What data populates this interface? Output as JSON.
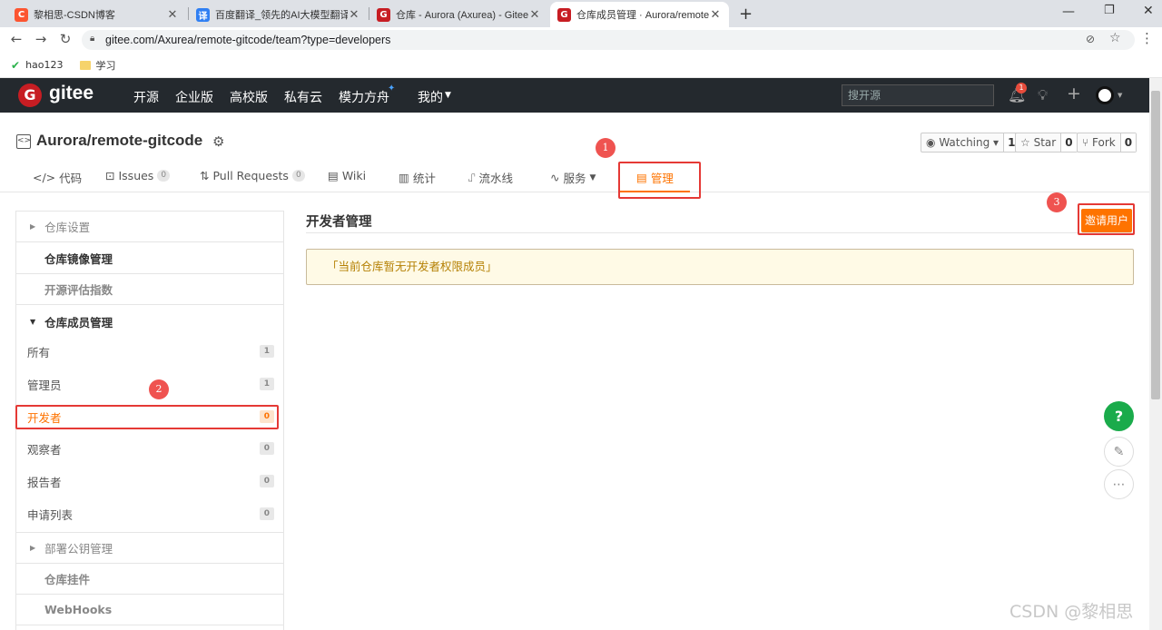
{
  "browser": {
    "tabs": [
      {
        "title": "黎相思-CSDN博客",
        "favicon_text": "C",
        "favicon_color": "#fc5531"
      },
      {
        "title": "百度翻译_领先的AI大模型翻译_支",
        "favicon_text": "译",
        "favicon_color": "#2f7ff3"
      },
      {
        "title": "仓库 - Aurora (Axurea) - Gitee.c",
        "favicon_text": "G",
        "favicon_color": "#c71d23"
      },
      {
        "title": "仓库成员管理 · Aurora/remote-g",
        "favicon_text": "G",
        "favicon_color": "#c71d23"
      }
    ],
    "url": "gitee.com/Axurea/remote-gitcode/team?type=developers",
    "bookmarks": [
      {
        "label": "hao123"
      },
      {
        "label": "学习"
      }
    ]
  },
  "gitee_header": {
    "brand": "gitee",
    "nav": [
      "开源",
      "企业版",
      "高校版",
      "私有云",
      "模力方舟",
      "我的"
    ],
    "search_placeholder": "搜开源",
    "notification_count": "1"
  },
  "repo": {
    "name": "Aurora/remote-gitcode",
    "watch_label": "Watching",
    "watch_count": "1",
    "star_label": "Star",
    "star_count": "0",
    "fork_label": "Fork",
    "fork_count": "0"
  },
  "repo_tabs": {
    "code": "代码",
    "issues": "Issues",
    "issues_count": "0",
    "pulls": "Pull Requests",
    "pulls_count": "0",
    "wiki": "Wiki",
    "stats": "统计",
    "pipeline": "流水线",
    "services": "服务",
    "manage": "管理"
  },
  "sidebar": {
    "repo_settings": "仓库设置",
    "mirror": "仓库镜像管理",
    "open_source_index": "开源评估指数",
    "members": "仓库成员管理",
    "member_items": [
      {
        "label": "所有",
        "count": "1"
      },
      {
        "label": "管理员",
        "count": "1"
      },
      {
        "label": "开发者",
        "count": "0"
      },
      {
        "label": "观察者",
        "count": "0"
      },
      {
        "label": "报告者",
        "count": "0"
      },
      {
        "label": "申请列表",
        "count": "0"
      }
    ],
    "deploy_keys": "部署公钥管理",
    "widgets": "仓库挂件",
    "webhooks": "WebHooks"
  },
  "main": {
    "title": "开发者管理",
    "invite_button": "邀请用户",
    "notice": "「当前仓库暂无开发者权限成员」"
  },
  "annotations": [
    "1",
    "2",
    "3"
  ],
  "floating": {
    "help": "?"
  },
  "watermark": "CSDN @黎相思",
  "colors": {
    "accent": "#fe7300",
    "header_bg": "#24292e",
    "annotation_red": "#e53935",
    "help_green": "#1aab4b"
  }
}
